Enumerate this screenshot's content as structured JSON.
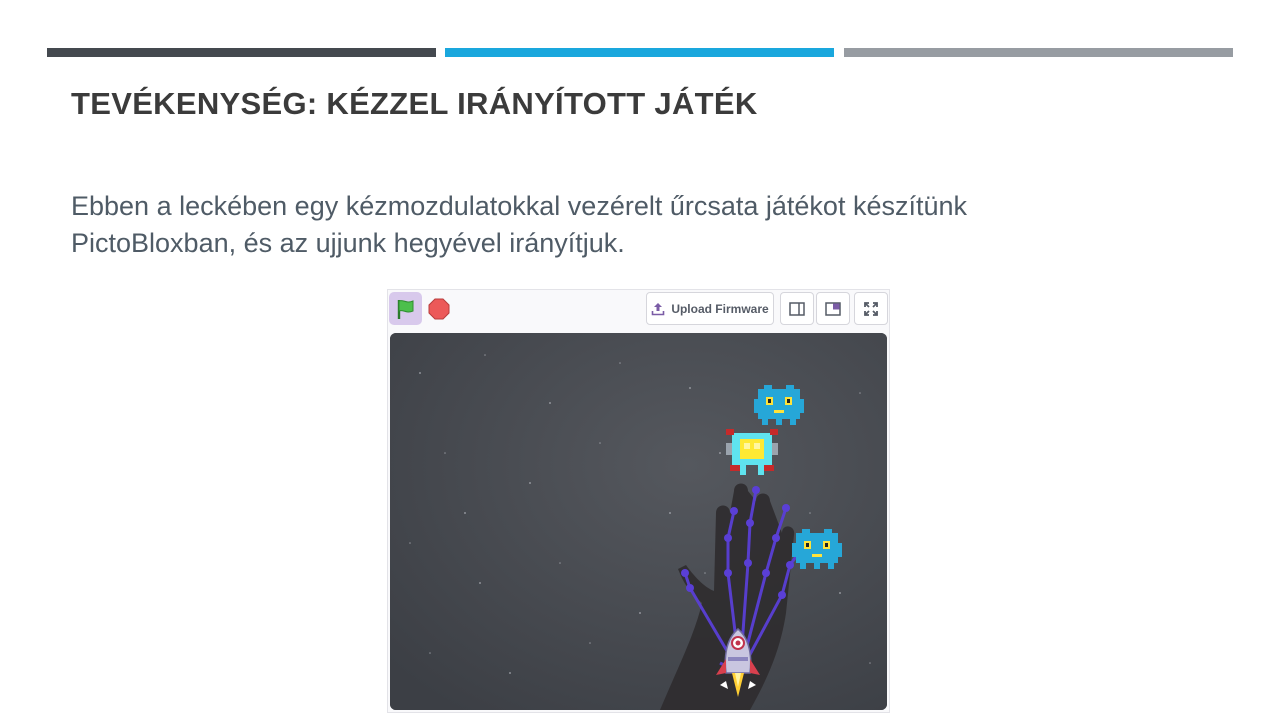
{
  "slide": {
    "title": "TEVÉKENYSÉG: KÉZZEL IRÁNYÍTOTT JÁTÉK",
    "body_line1": "Ebben a leckében egy kézmozdulatokkal vezérelt űrcsata játékot készítünk",
    "body_line2": "PictoBloxban, és az ujjunk hegyével irányítjuk.",
    "accent_colors": [
      "#44494f",
      "#1aa7dd",
      "#979ca2"
    ]
  },
  "toolbar": {
    "green_flag_icon": "green-flag-icon",
    "stop_icon": "stop-icon",
    "upload_label": "Upload Firmware",
    "upload_icon": "upload-icon",
    "small_stage_icon": "small-stage-icon",
    "large_stage_icon": "large-stage-icon",
    "fullscreen_icon": "fullscreen-icon"
  },
  "stage": {
    "background": "space",
    "sprites": [
      "alien-blue",
      "alien-yellow-robot",
      "alien-blue",
      "hand-tracking-overlay",
      "rocket-ship"
    ]
  }
}
